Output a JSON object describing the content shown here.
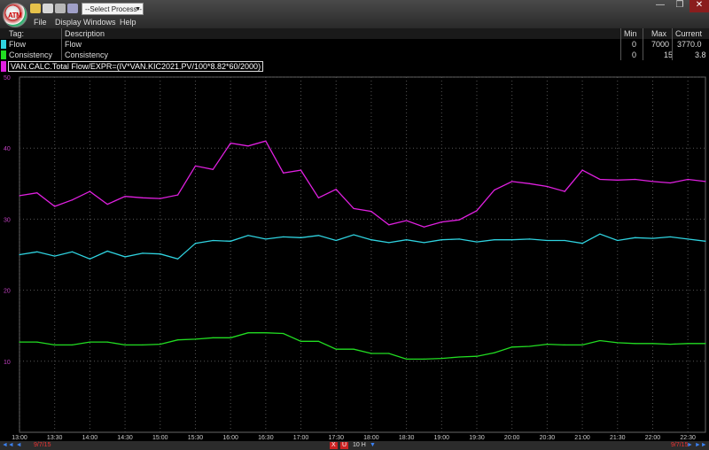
{
  "toolbar": {
    "process_select": "--Select Process--",
    "menus": [
      "File",
      "Display",
      "Windows",
      "Help"
    ],
    "logo_text": "ATM"
  },
  "window_buttons": [
    "—",
    "❐",
    "✕"
  ],
  "tag_table": {
    "headers": {
      "tag": "Tag:",
      "description": "Description",
      "min": "Min",
      "max": "Max",
      "current": "Current"
    },
    "rows": [
      {
        "tag": "Flow",
        "description": "Flow",
        "min": "0",
        "max": "7000",
        "current": "3770.0",
        "color": "#2fd3e0"
      },
      {
        "tag": "Consistency",
        "description": "Consistency",
        "min": "0",
        "max": "15",
        "current": "3.8",
        "color": "#22dd22"
      }
    ]
  },
  "expression": {
    "text": "VAN.CALC.Total Flow/EXPR=(IV*VAN.KIC2021.PV/100*8.82*60/2000)",
    "color": "#e020e0"
  },
  "chart_data": {
    "type": "line",
    "x": [
      "13:00",
      "13:15",
      "13:30",
      "13:45",
      "14:00",
      "14:15",
      "14:30",
      "14:45",
      "15:00",
      "15:15",
      "15:30",
      "15:45",
      "16:00",
      "16:15",
      "16:30",
      "16:45",
      "17:00",
      "17:15",
      "17:30",
      "17:45",
      "18:00",
      "18:15",
      "18:30",
      "18:45",
      "19:00",
      "19:15",
      "19:30",
      "19:45",
      "20:00",
      "20:15",
      "20:30",
      "20:45",
      "21:00",
      "21:15",
      "21:30",
      "21:45",
      "22:00",
      "22:15",
      "22:30",
      "22:45"
    ],
    "xticks": [
      "13:00",
      "13:30",
      "14:00",
      "14:30",
      "15:00",
      "15:30",
      "16:00",
      "16:30",
      "17:00",
      "17:30",
      "18:00",
      "18:30",
      "19:00",
      "19:30",
      "20:00",
      "20:30",
      "21:00",
      "21:30",
      "22:00",
      "22:30"
    ],
    "yticks": [
      "10",
      "20",
      "30",
      "40",
      "50"
    ],
    "ylim": [
      0,
      50
    ],
    "grid": true,
    "series": [
      {
        "name": "VAN.CALC.Total Flow",
        "color": "#e020e0",
        "values": [
          33.3,
          33.7,
          31.8,
          32.7,
          33.9,
          32.1,
          33.2,
          33.0,
          32.9,
          33.4,
          37.5,
          37.0,
          40.7,
          40.3,
          41.0,
          36.5,
          36.9,
          33.0,
          34.2,
          31.5,
          31.1,
          29.2,
          29.8,
          28.9,
          29.6,
          29.9,
          31.2,
          34.1,
          35.3,
          35.0,
          34.6,
          33.9,
          36.9,
          35.6,
          35.5,
          35.6,
          35.3,
          35.1,
          35.6,
          35.3
        ]
      },
      {
        "name": "Flow",
        "color": "#2fd3e0",
        "values": [
          25.0,
          25.4,
          24.8,
          25.4,
          24.4,
          25.5,
          24.7,
          25.2,
          25.1,
          24.4,
          26.6,
          27.0,
          26.9,
          27.7,
          27.2,
          27.5,
          27.4,
          27.7,
          27.0,
          27.8,
          27.1,
          26.7,
          27.1,
          26.7,
          27.1,
          27.2,
          26.8,
          27.1,
          27.1,
          27.2,
          27.0,
          27.0,
          26.6,
          27.9,
          27.0,
          27.4,
          27.3,
          27.5,
          27.2,
          26.9
        ]
      },
      {
        "name": "Consistency",
        "color": "#22dd22",
        "values": [
          12.7,
          12.7,
          12.3,
          12.3,
          12.7,
          12.7,
          12.3,
          12.3,
          12.4,
          13.0,
          13.1,
          13.3,
          13.3,
          14.0,
          14.0,
          13.9,
          12.8,
          12.8,
          11.7,
          11.7,
          11.1,
          11.1,
          10.3,
          10.3,
          10.4,
          10.6,
          10.7,
          11.2,
          12.0,
          12.1,
          12.4,
          12.3,
          12.3,
          12.9,
          12.6,
          12.5,
          12.5,
          12.4,
          12.5,
          12.5
        ]
      }
    ]
  },
  "bottom_bar": {
    "start_date": "9/7/15",
    "end_date": "9/7/15",
    "span": "10 H",
    "nav_left": "◄◄ ◄",
    "nav_right": "► ►►",
    "x_label": "X",
    "u_label": "U"
  }
}
